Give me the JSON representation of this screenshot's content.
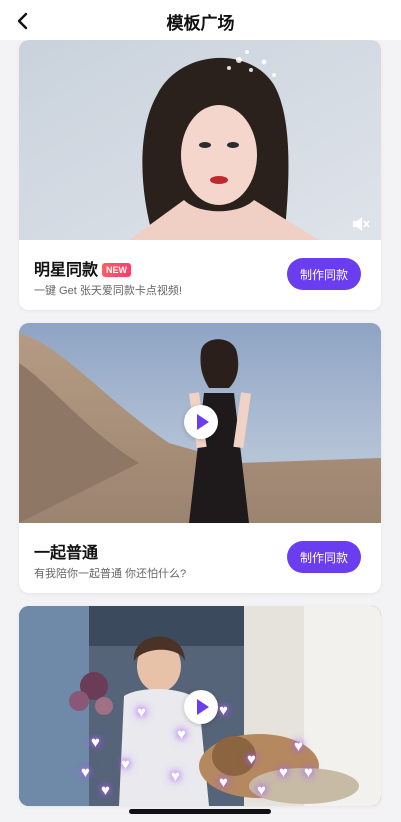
{
  "header": {
    "title": "模板广场"
  },
  "cards": [
    {
      "title": "明星同款",
      "badge": "NEW",
      "subtitle": "一键 Get 张天爱同款卡点视频!",
      "button": "制作同款"
    },
    {
      "title": "一起普通",
      "subtitle": "有我陪你一起普通 你还怕什么?",
      "button": "制作同款"
    },
    {
      "title": "",
      "subtitle": "",
      "button": ""
    }
  ],
  "colors": {
    "accent": "#6a3df0",
    "background": "#f3f3f5",
    "badge": "#ff4a63"
  },
  "icons": [
    "back-arrow-icon",
    "mute-icon",
    "play-icon",
    "heart-icon"
  ]
}
